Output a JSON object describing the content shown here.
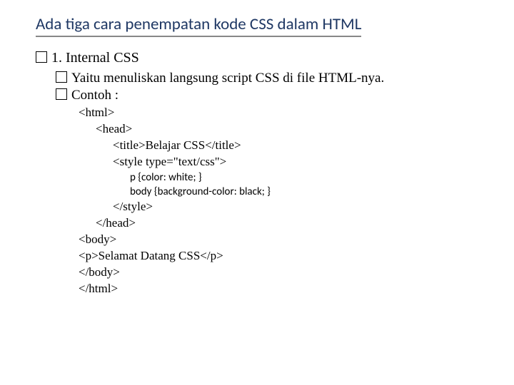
{
  "title": "Ada tiga cara penempatan kode CSS dalam HTML",
  "item1": "1. Internal CSS",
  "sub1": "Yaitu menuliskan langsung script CSS di file HTML-nya.",
  "sub2": "Contoh :",
  "code": {
    "l1": "<html>",
    "l2": "<head>",
    "l3": "<title>Belajar CSS</title>",
    "l4": "<style type=\"text/css\">",
    "l5": "p {color: white; }",
    "l6": "body {background-color: black; }",
    "l7": "</style>",
    "l8": "</head>",
    "l9": "<body>",
    "l10": "<p>Selamat Datang CSS</p>",
    "l11": "</body>",
    "l12": "</html>"
  }
}
